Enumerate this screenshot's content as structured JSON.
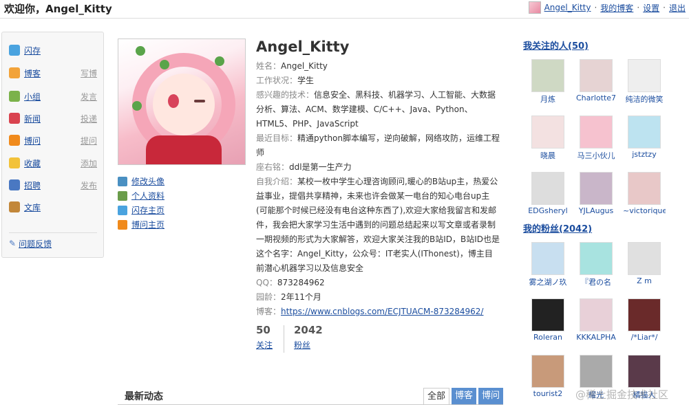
{
  "header": {
    "welcome": "欢迎你，Angel_Kitty",
    "username": "Angel_Kitty",
    "links": [
      "我的博客",
      "设置",
      "退出"
    ],
    "separator": "·"
  },
  "sidebar": {
    "items": [
      {
        "label": "闪存",
        "sub": "",
        "icon": "chat-bubble-icon",
        "color": "#4aa3df"
      },
      {
        "label": "博客",
        "sub": "写博",
        "icon": "notepad-icon",
        "color": "#f2a33a"
      },
      {
        "label": "小组",
        "sub": "发言",
        "icon": "group-icon",
        "color": "#7bb24a"
      },
      {
        "label": "新闻",
        "sub": "投递",
        "icon": "news-icon",
        "color": "#d9434f"
      },
      {
        "label": "博问",
        "sub": "提问",
        "icon": "question-icon",
        "color": "#f08a1c"
      },
      {
        "label": "收藏",
        "sub": "添加",
        "icon": "folder-icon",
        "color": "#f2c23a"
      },
      {
        "label": "招聘",
        "sub": "发布",
        "icon": "person-card-icon",
        "color": "#4a78c2"
      },
      {
        "label": "文库",
        "sub": "",
        "icon": "book-icon",
        "color": "#c2873a"
      }
    ],
    "feedback": "问题反馈"
  },
  "avatar_links": [
    {
      "label": "修改头像",
      "icon": "gear-icon",
      "color": "#4a90c2"
    },
    {
      "label": "个人资料",
      "icon": "id-card-icon",
      "color": "#6a9c4a"
    },
    {
      "label": "闪存主页",
      "icon": "chat-bubble-icon",
      "color": "#4aa3df"
    },
    {
      "label": "博问主页",
      "icon": "question-icon",
      "color": "#f08a1c"
    }
  ],
  "profile": {
    "name": "Angel_Kitty",
    "fields": [
      {
        "label": "姓名：",
        "value": "Angel_Kitty"
      },
      {
        "label": "工作状况：",
        "value": "学生"
      },
      {
        "label": "感兴趣的技术：",
        "value": "信息安全、黑科技、机器学习、人工智能、大数据分析、算法、ACM、数学建模、C/C++、Java、Python、HTML5、PHP、JavaScript"
      },
      {
        "label": "最近目标：",
        "value": "精通python脚本编写，逆向破解，网络攻防，运维工程师"
      },
      {
        "label": "座右铭：",
        "value": "ddl是第一生产力"
      },
      {
        "label": "自我介绍：",
        "value": "某校一枚中学生心理咨询顾问,暖心的B站up主，热爱公益事业，提倡共享精神，未来也许会做某一电台的知心电台up主(可能那个时候已经没有电台这种东西了),欢迎大家给我留言和发邮件，我会把大家学习生活中遇到的问题总结起来以写文章或者录制一期视频的形式为大家解答，欢迎大家关注我的B站ID，B站ID也是这个名字：Angel_Kitty，公众号：IT老实人(IThonest)，博主目前潜心机器学习以及信息安全"
      },
      {
        "label": "QQ：",
        "value": "873284962"
      },
      {
        "label": "园龄：",
        "value": "2年11个月"
      },
      {
        "label": "博客：",
        "value": "https://www.cnblogs.com/ECJTUACM-873284962/"
      }
    ]
  },
  "stats": [
    {
      "num": "50",
      "label": "关注"
    },
    {
      "num": "2042",
      "label": "粉丝"
    }
  ],
  "feed": {
    "title": "最新动态",
    "tabs": [
      "全部",
      "博客",
      "博问"
    ]
  },
  "following": {
    "title": "我关注的人(50)",
    "people": [
      "月炼",
      "Charlotte7",
      "纯洁的微笑",
      "晓晨",
      "马三小伙儿",
      "jstztzy",
      "EDGsheryl",
      "YJLAugus",
      "~victorique"
    ]
  },
  "fans": {
    "title": "我的粉丝(2042)",
    "people": [
      "雾之湖ノ玖",
      "『君の名",
      "Z m",
      "Roleran",
      "KKKALPHA",
      "/*Liar*/",
      "tourist2",
      "耀光",
      "橘猫人"
    ]
  },
  "watermark": "@稀土掘金技术社区"
}
